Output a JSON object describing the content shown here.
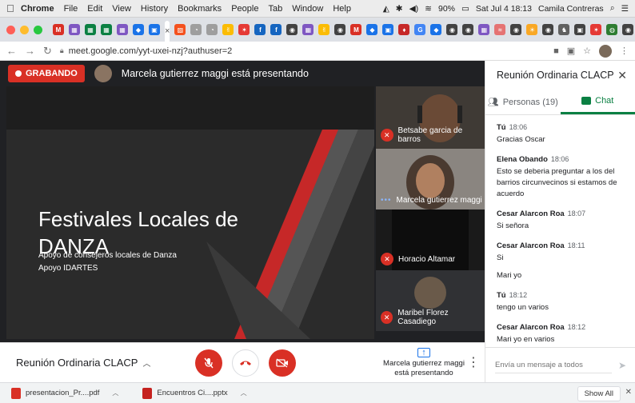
{
  "menubar": {
    "app": "Chrome",
    "items": [
      "File",
      "Edit",
      "View",
      "History",
      "Bookmarks",
      "People",
      "Tab",
      "Window",
      "Help"
    ],
    "battery": "90%",
    "clock": "Sat Jul 4  18:13",
    "user": "Camila Contreras"
  },
  "tabs": {
    "active_close": "×",
    "favicons": [
      {
        "color": "#d93025",
        "glyph": "M"
      },
      {
        "color": "#7e57c2",
        "glyph": "▦"
      },
      {
        "color": "#0b8043",
        "glyph": "▦"
      },
      {
        "color": "#0b8043",
        "glyph": "▦"
      },
      {
        "color": "#7e57c2",
        "glyph": "▦"
      },
      {
        "color": "#1a73e8",
        "glyph": "◆"
      },
      {
        "color": "#1a73e8",
        "glyph": "▣"
      },
      {
        "color": "#f4511e",
        "glyph": "▨"
      },
      {
        "color": "#9e9e9e",
        "glyph": "◔"
      },
      {
        "color": "#9e9e9e",
        "glyph": "◔"
      },
      {
        "color": "#fbbc04",
        "glyph": "✌"
      },
      {
        "color": "#e53935",
        "glyph": "✶"
      },
      {
        "color": "#1565c0",
        "glyph": "f"
      },
      {
        "color": "#1565c0",
        "glyph": "f"
      },
      {
        "color": "#424242",
        "glyph": "◉"
      },
      {
        "color": "#7e57c2",
        "glyph": "▦"
      },
      {
        "color": "#fbbc04",
        "glyph": "✌"
      },
      {
        "color": "#424242",
        "glyph": "◉"
      },
      {
        "color": "#d93025",
        "glyph": "M"
      },
      {
        "color": "#1a73e8",
        "glyph": "◆"
      },
      {
        "color": "#1a73e8",
        "glyph": "▣"
      },
      {
        "color": "#c62828",
        "glyph": "♦"
      },
      {
        "color": "#4285f4",
        "glyph": "G"
      },
      {
        "color": "#1a73e8",
        "glyph": "◆"
      },
      {
        "color": "#424242",
        "glyph": "◉"
      },
      {
        "color": "#424242",
        "glyph": "◉"
      },
      {
        "color": "#7e57c2",
        "glyph": "▦"
      },
      {
        "color": "#e57373",
        "glyph": "≈"
      },
      {
        "color": "#424242",
        "glyph": "◉"
      },
      {
        "color": "#f9a825",
        "glyph": "☀"
      },
      {
        "color": "#424242",
        "glyph": "◉"
      },
      {
        "color": "#616161",
        "glyph": "♞"
      },
      {
        "color": "#424242",
        "glyph": "▣"
      },
      {
        "color": "#e53935",
        "glyph": "✶"
      },
      {
        "color": "#2e7d32",
        "glyph": "◍"
      },
      {
        "color": "#424242",
        "glyph": "◉"
      }
    ],
    "new_tab": "+"
  },
  "address": {
    "url": "meet.google.com/yyt-uxei-nzj?authuser=2"
  },
  "meet": {
    "recording_label": "GRABANDO",
    "presenting_banner": "Marcela gutierrez maggi está presentando",
    "slide": {
      "title_line1": "Festivales Locales de",
      "title_line2": "DANZA",
      "subtitle_line1": "Apoyo de consejeros locales de Danza",
      "subtitle_line2": "Apoyo IDARTES"
    },
    "participants": [
      {
        "name": "Betsabe garcia de barros",
        "muted": true
      },
      {
        "name": "Marcela gutierrez maggi",
        "muted": false
      },
      {
        "name": "Horacio Altamar",
        "muted": true
      },
      {
        "name": "Maribel Florez Casadiego",
        "muted": true
      }
    ],
    "meeting_name": "Reunión Ordinaria CLACP",
    "present_status_line1": "Marcela gutierrez maggi",
    "present_status_line2": "está presentando"
  },
  "panel": {
    "title": "Reunión Ordinaria CLACP",
    "tab_people": "Personas (19)",
    "tab_chat": "Chat",
    "messages": [
      {
        "who": "Tú",
        "time": "18:06",
        "lines": [
          "Gracias Oscar"
        ]
      },
      {
        "who": "Elena Obando",
        "time": "18:06",
        "lines": [
          "Esto se deberia preguntar a los del barrios circunvecinos si estamos de acuerdo"
        ]
      },
      {
        "who": "Cesar Alarcon Roa",
        "time": "18:07",
        "lines": [
          "Si señora"
        ]
      },
      {
        "who": "Cesar Alarcon Roa",
        "time": "18:11",
        "lines": [
          "Si",
          "Mari yo"
        ]
      },
      {
        "who": "Tú",
        "time": "18:12",
        "lines": [
          "tengo un varios"
        ]
      },
      {
        "who": "Cesar Alarcon Roa",
        "time": "18:12",
        "lines": [
          "Mari yo en varios"
        ]
      }
    ],
    "compose_placeholder": "Envía un mensaje a todos"
  },
  "downloads": {
    "items": [
      {
        "name": "presentacion_Pr....pdf",
        "color": "#d93025"
      },
      {
        "name": "Encuentros Ci....pptx",
        "color": "#c5221f"
      }
    ],
    "show_all": "Show All"
  }
}
